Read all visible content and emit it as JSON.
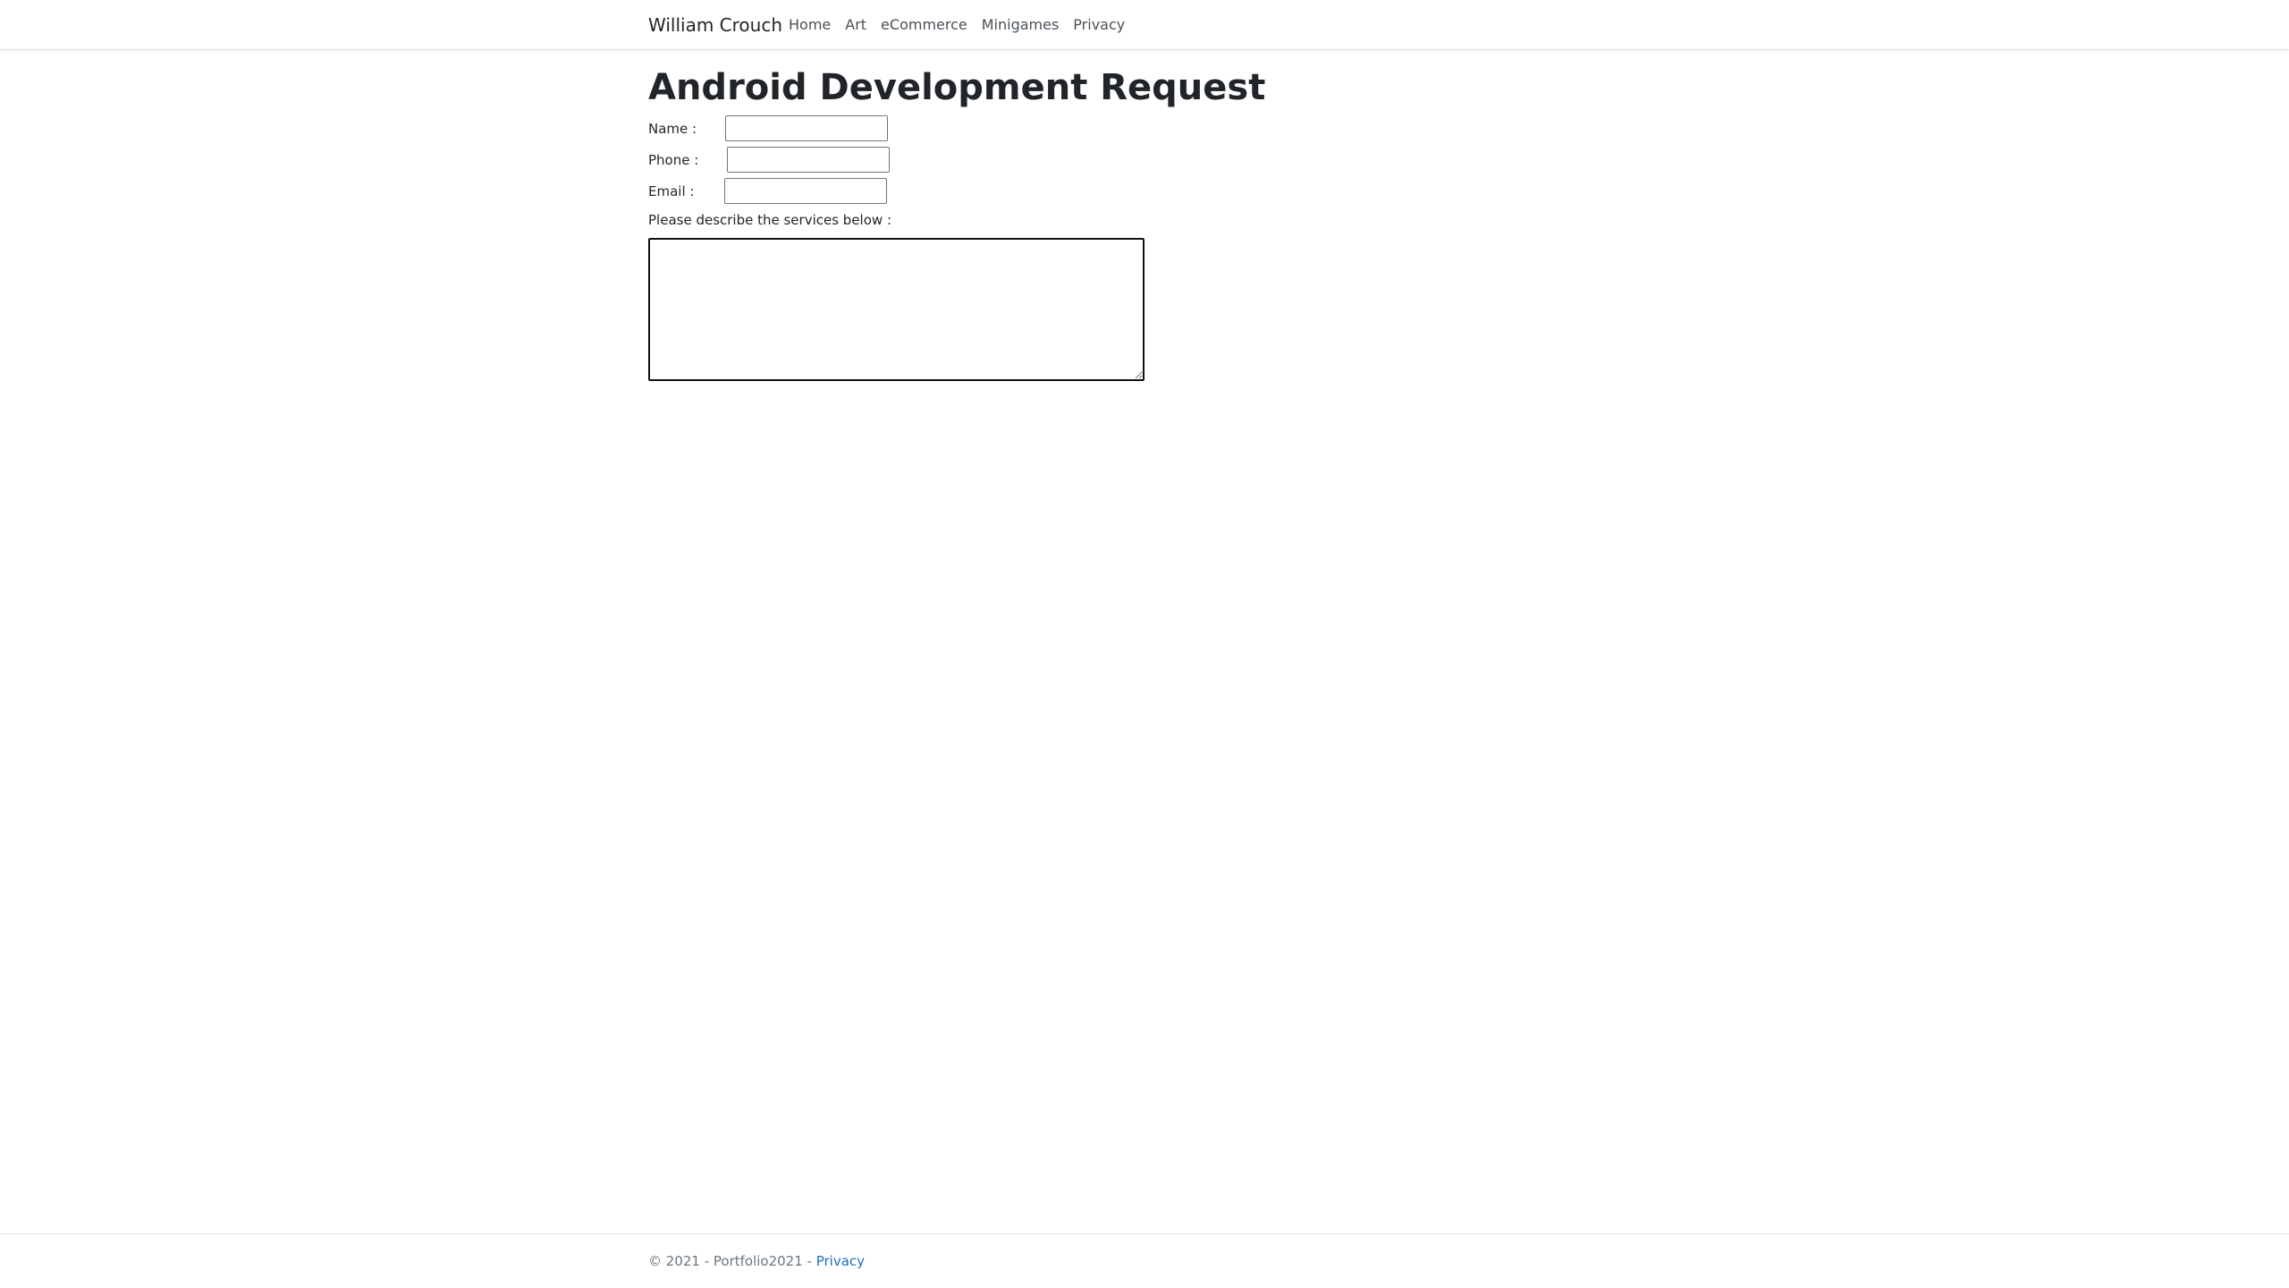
{
  "navbar": {
    "brand": "William Crouch",
    "links": [
      "Home",
      "Art",
      "eCommerce",
      "Minigames",
      "Privacy"
    ]
  },
  "form": {
    "title": "Android Development Request",
    "name_label": "Name :",
    "phone_label": "Phone :",
    "email_label": "Email :",
    "name_value": "",
    "phone_value": "",
    "email_value": "",
    "services_label": "Please describe the services below :",
    "services_value": ""
  },
  "footer": {
    "copyright": "© 2021 - Portfolio2021 - ",
    "privacy_link": "Privacy"
  },
  "colors": {
    "link": "#1b6ec2",
    "text": "#212529",
    "muted": "#6c757d"
  }
}
